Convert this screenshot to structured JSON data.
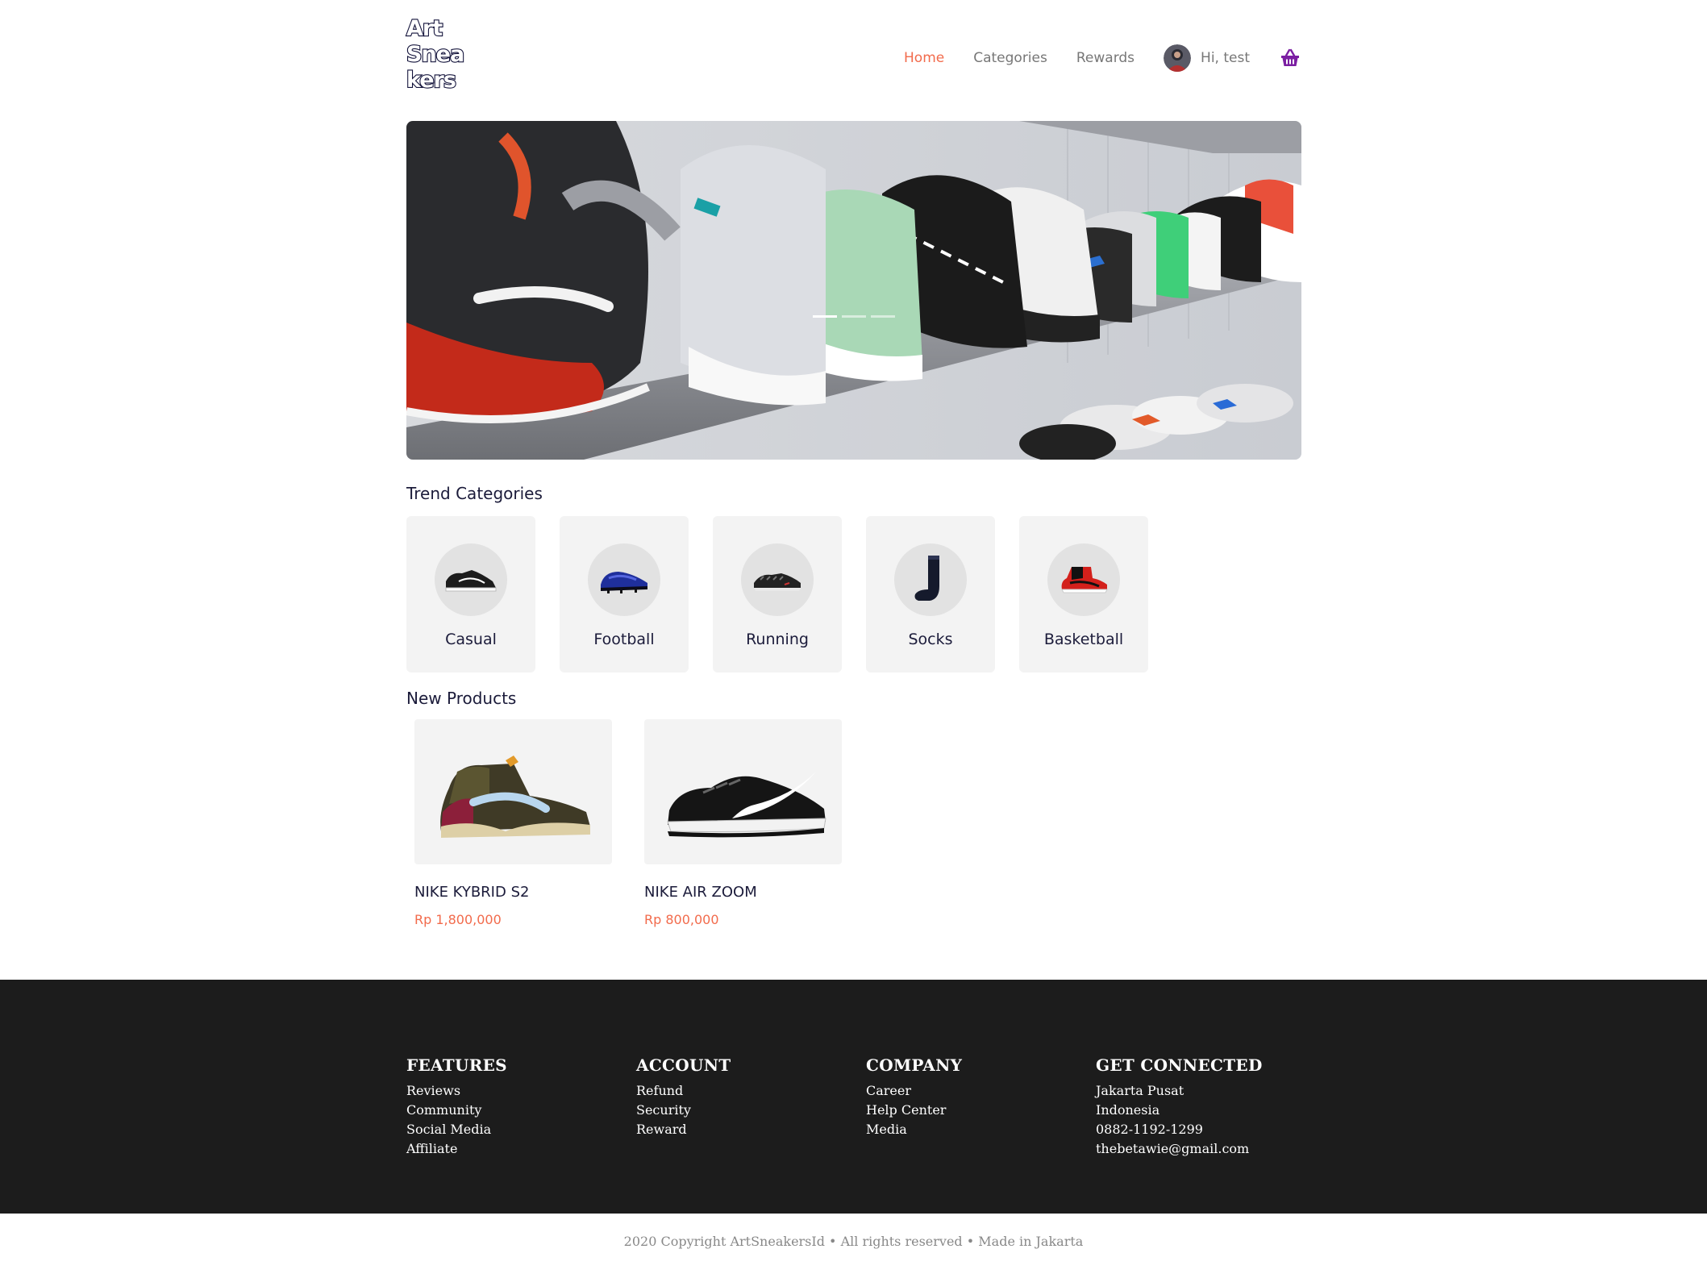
{
  "brand": {
    "logo_lines": [
      "Art",
      "Snea",
      "kers"
    ]
  },
  "nav": {
    "items": [
      {
        "label": "Home",
        "active": true
      },
      {
        "label": "Categories",
        "active": false
      },
      {
        "label": "Rewards",
        "active": false
      }
    ],
    "user_greeting": "Hi, test",
    "cart_icon": "basket-icon"
  },
  "hero": {
    "slides": 3,
    "active_slide": 1
  },
  "trend": {
    "title": "Trend Categories",
    "categories": [
      {
        "label": "Casual",
        "icon": "casual-shoe-icon"
      },
      {
        "label": "Football",
        "icon": "football-boot-icon"
      },
      {
        "label": "Running",
        "icon": "running-shoe-icon"
      },
      {
        "label": "Socks",
        "icon": "sock-icon"
      },
      {
        "label": "Basketball",
        "icon": "basketball-shoe-icon"
      }
    ]
  },
  "new_products": {
    "title": "New Products",
    "items": [
      {
        "name": "NIKE KYBRID S2",
        "price": "Rp 1,800,000"
      },
      {
        "name": "NIKE AIR ZOOM",
        "price": "Rp 800,000"
      }
    ]
  },
  "footer": {
    "features": {
      "heading": "FEATURES",
      "links": [
        "Reviews",
        "Community",
        "Social Media",
        "Affiliate"
      ]
    },
    "account": {
      "heading": "ACCOUNT",
      "links": [
        "Refund",
        "Security",
        "Reward"
      ]
    },
    "company": {
      "heading": "COMPANY",
      "links": [
        "Career",
        "Help Center",
        "Media"
      ]
    },
    "connect": {
      "heading": "GET CONNECTED",
      "lines": [
        "Jakarta Pusat",
        "Indonesia",
        "0882-1192-1299",
        "thebetawie@gmail.com"
      ]
    },
    "copyright": "2020 Copyright ArtSneakersId • All rights reserved • Made in Jakarta"
  },
  "colors": {
    "accent": "#f26b4c",
    "cart": "#7b1fa2",
    "footer_bg": "#1c1c1c",
    "card_bg": "#f3f3f3"
  }
}
